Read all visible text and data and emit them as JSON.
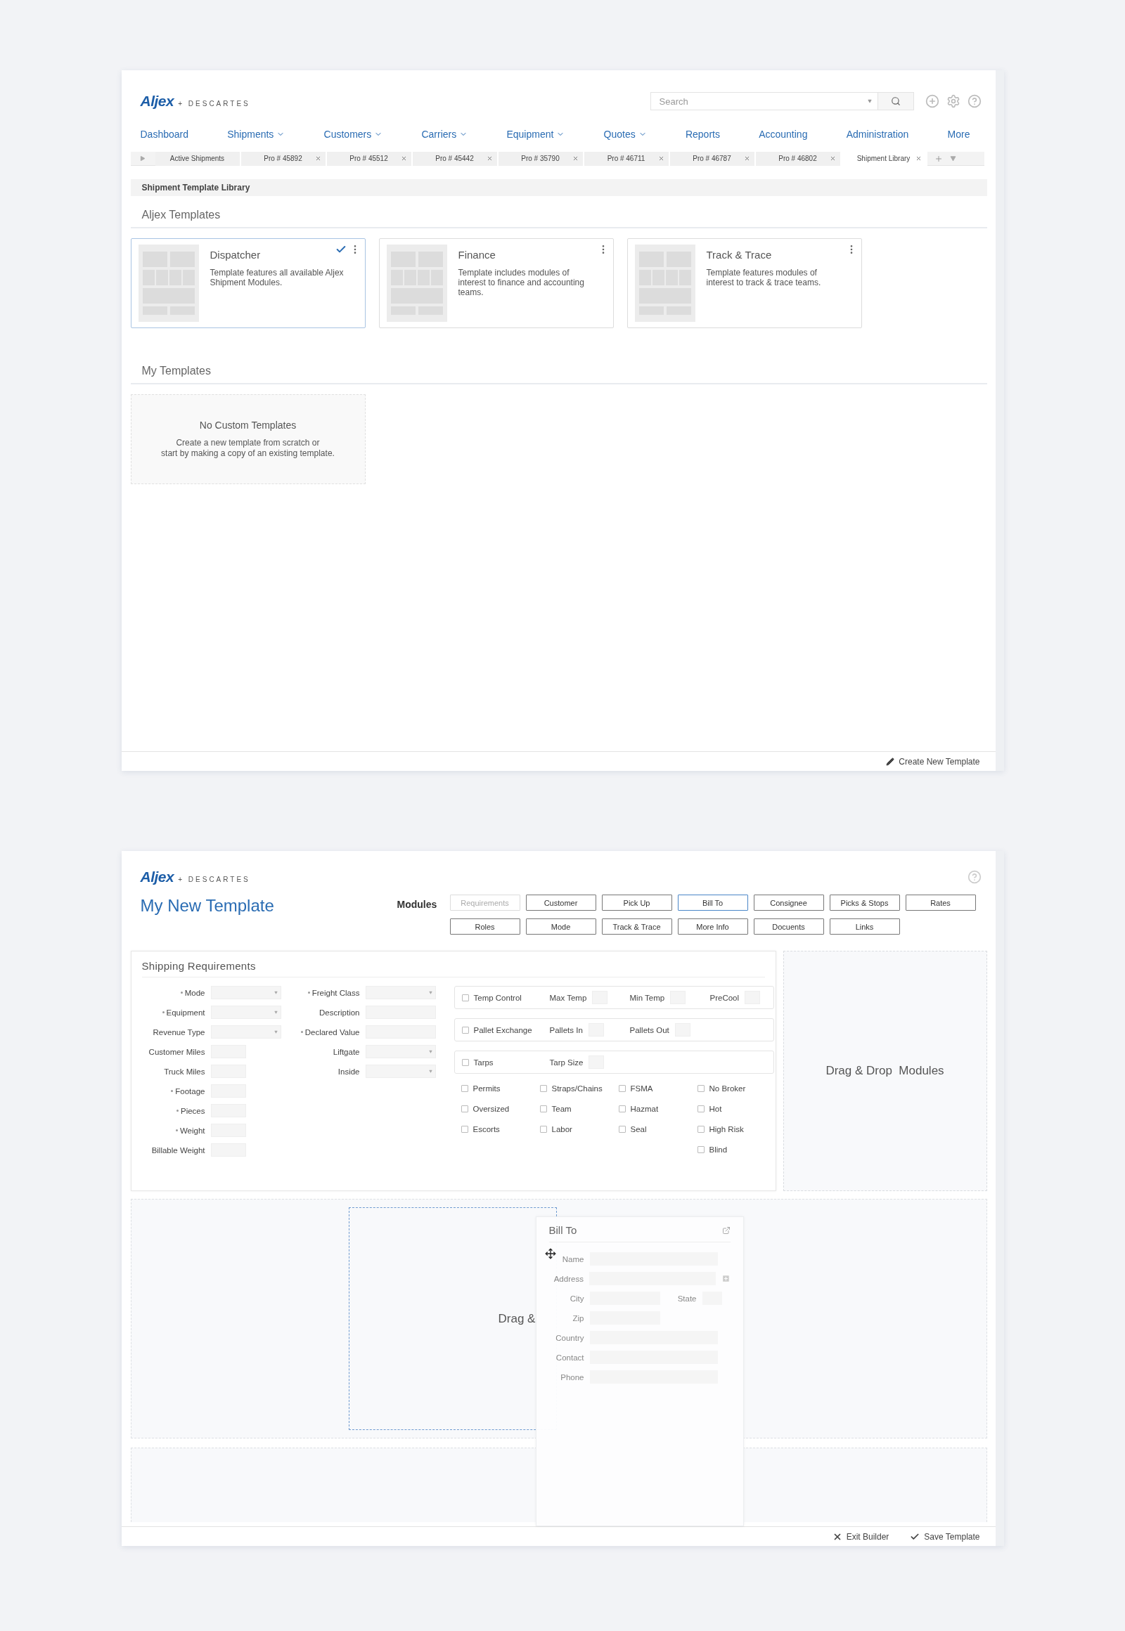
{
  "library": {
    "logo": {
      "brand": "Aljex",
      "plus": "+",
      "partner": "DESCARTES"
    },
    "search": {
      "placeholder": "Search"
    },
    "nav": [
      {
        "label": "Dashboard",
        "dropdown": false
      },
      {
        "label": "Shipments",
        "dropdown": true
      },
      {
        "label": "Customers",
        "dropdown": true
      },
      {
        "label": "Carriers",
        "dropdown": true
      },
      {
        "label": "Equipment",
        "dropdown": true
      },
      {
        "label": "Quotes",
        "dropdown": true
      },
      {
        "label": "Reports",
        "dropdown": false
      },
      {
        "label": "Accounting",
        "dropdown": false
      },
      {
        "label": "Administration",
        "dropdown": false
      },
      {
        "label": "More",
        "dropdown": false
      }
    ],
    "tabs": [
      {
        "label": "Active Shipments",
        "closable": false,
        "selected": false
      },
      {
        "label": "Pro # 45892",
        "closable": true,
        "selected": false
      },
      {
        "label": "Pro # 45512",
        "closable": true,
        "selected": false
      },
      {
        "label": "Pro # 45442",
        "closable": true,
        "selected": false
      },
      {
        "label": "Pro # 35790",
        "closable": true,
        "selected": false
      },
      {
        "label": "Pro # 46711",
        "closable": true,
        "selected": false
      },
      {
        "label": "Pro # 46787",
        "closable": true,
        "selected": false
      },
      {
        "label": "Pro # 46802",
        "closable": true,
        "selected": false
      },
      {
        "label": "Shipment Library",
        "closable": true,
        "selected": true
      }
    ],
    "breadcrumb": "Shipment Template Library",
    "aljex_templates": {
      "title": "Aljex Templates",
      "cards": [
        {
          "name": "Dispatcher",
          "description": "Template features all available Aljex Shipment Modules.",
          "selected": true
        },
        {
          "name": "Finance",
          "description": "Template includes modules of interest to finance and accounting teams.",
          "selected": false
        },
        {
          "name": "Track & Trace",
          "description": "Template features modules of interest to track & trace teams.",
          "selected": false
        }
      ]
    },
    "my_templates": {
      "title": "My Templates",
      "empty_title": "No Custom Templates",
      "empty_text": "Create a new template from scratch or\nstart by making a copy of an existing template."
    },
    "footer_action": "Create New Template"
  },
  "builder": {
    "logo": {
      "brand": "Aljex",
      "plus": "+",
      "partner": "DESCARTES"
    },
    "title": "My New Template",
    "modules_label": "Modules",
    "modules": [
      {
        "label": "Requirements",
        "disabled": true,
        "selected": false
      },
      {
        "label": "Customer",
        "disabled": false,
        "selected": false
      },
      {
        "label": "Pick Up",
        "disabled": false,
        "selected": false
      },
      {
        "label": "Bill To",
        "disabled": false,
        "selected": true
      },
      {
        "label": "Consignee",
        "disabled": false,
        "selected": false
      },
      {
        "label": "Picks & Stops",
        "disabled": false,
        "selected": false
      },
      {
        "label": "Rates",
        "disabled": false,
        "selected": false
      },
      {
        "label": "Roles",
        "disabled": false,
        "selected": false
      },
      {
        "label": "Mode",
        "disabled": false,
        "selected": false
      },
      {
        "label": "Track & Trace",
        "disabled": false,
        "selected": false
      },
      {
        "label": "More Info",
        "disabled": false,
        "selected": false
      },
      {
        "label": "Docuents",
        "disabled": false,
        "selected": false
      },
      {
        "label": "Links",
        "disabled": false,
        "selected": false
      }
    ],
    "requirements": {
      "title": "Shipping Requirements",
      "left_fields": [
        {
          "label": "Mode",
          "required": true,
          "kind": "select"
        },
        {
          "label": "Equipment",
          "required": true,
          "kind": "select"
        },
        {
          "label": "Revenue Type",
          "required": false,
          "kind": "select"
        },
        {
          "label": "Customer Miles",
          "required": false,
          "kind": "short"
        },
        {
          "label": "Truck Miles",
          "required": false,
          "kind": "short"
        },
        {
          "label": "Footage",
          "required": true,
          "kind": "short"
        },
        {
          "label": "Pieces",
          "required": true,
          "kind": "short"
        },
        {
          "label": "Weight",
          "required": true,
          "kind": "short"
        },
        {
          "label": "Billable Weight",
          "required": false,
          "kind": "short"
        }
      ],
      "middle_fields": [
        {
          "label": "Freight Class",
          "required": true,
          "kind": "select"
        },
        {
          "label": "Description",
          "required": false,
          "kind": "text"
        },
        {
          "label": "Declared Value",
          "required": true,
          "kind": "text"
        },
        {
          "label": "Liftgate",
          "required": false,
          "kind": "select"
        },
        {
          "label": "Inside",
          "required": false,
          "kind": "select"
        }
      ],
      "option_groups": [
        {
          "label": "Temp Control",
          "checked": false,
          "fields": [
            "Max Temp",
            "Min Temp",
            "PreCool"
          ]
        },
        {
          "label": "Pallet Exchange",
          "checked": false,
          "fields": [
            "Pallets In",
            "Pallets Out"
          ]
        },
        {
          "label": "Tarps",
          "checked": false,
          "fields": [
            "Tarp Size"
          ]
        }
      ],
      "checkbox_columns": [
        [
          {
            "label": "Permits",
            "checked": false
          },
          {
            "label": "Oversized",
            "checked": false
          },
          {
            "label": "Escorts",
            "checked": false
          }
        ],
        [
          {
            "label": "Straps/Chains",
            "checked": false
          },
          {
            "label": "Team",
            "checked": false
          },
          {
            "label": "Labor",
            "checked": false
          }
        ],
        [
          {
            "label": "FSMA",
            "checked": false
          },
          {
            "label": "Hazmat",
            "checked": false
          },
          {
            "label": "Seal",
            "checked": false
          }
        ],
        [
          {
            "label": "No Broker",
            "checked": false
          },
          {
            "label": "Hot",
            "checked": false
          },
          {
            "label": "High Risk",
            "checked": false
          },
          {
            "label": "Blind",
            "checked": false
          }
        ]
      ]
    },
    "side_drop": "Drag & Drop  Modules",
    "main_drop": "Drag &",
    "dragged_module": {
      "title": "Bill To",
      "fields": [
        {
          "label": "Name",
          "kind": "wide",
          "addable": false
        },
        {
          "label": "Address",
          "kind": "wide",
          "addable": true
        },
        {
          "label": "City",
          "kind": "medium",
          "addable": false,
          "extra": "State"
        },
        {
          "label": "Zip",
          "kind": "medium",
          "addable": false
        },
        {
          "label": "Country",
          "kind": "wide",
          "addable": false
        },
        {
          "label": "Contact",
          "kind": "wide",
          "addable": false
        },
        {
          "label": "Phone",
          "kind": "wide",
          "addable": false
        }
      ]
    },
    "actions": [
      {
        "label": "Exit Builder",
        "kind": "exit"
      },
      {
        "label": "Save Template",
        "kind": "save"
      }
    ]
  }
}
